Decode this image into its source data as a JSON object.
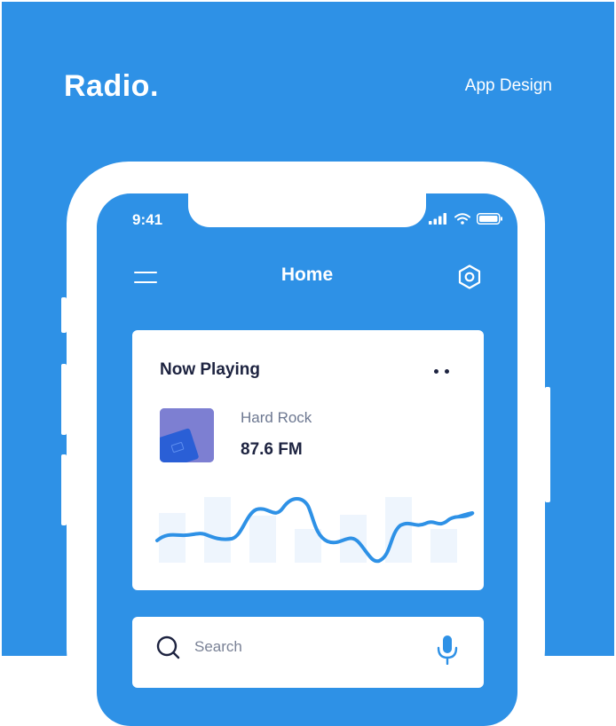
{
  "brand": {
    "title": "Radio.",
    "tagline": "App Design"
  },
  "colors": {
    "primary": "#2e91e6",
    "card": "#ffffff",
    "text_dark": "#1d2340",
    "text_muted": "#6d7891",
    "album": "#7d7fd2"
  },
  "status_bar": {
    "time": "9:41",
    "icons": [
      "signal-icon",
      "wifi-icon",
      "battery-icon"
    ]
  },
  "nav": {
    "title": "Home",
    "left_icon": "menu-icon",
    "right_icon": "settings-icon"
  },
  "now_playing": {
    "title": "Now Playing",
    "menu_icon": "more-dots-icon",
    "genre": "Hard Rock",
    "frequency": "87.6 FM",
    "album_art": "album-cover-image"
  },
  "search": {
    "placeholder": "Search",
    "value": "",
    "left_icon": "search-icon",
    "right_icon": "microphone-icon"
  }
}
